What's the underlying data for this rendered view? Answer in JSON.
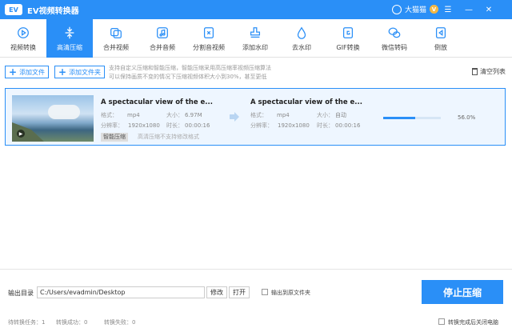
{
  "app": {
    "logo_text": "EV",
    "title": "EV视频转换器"
  },
  "user": {
    "name": "大猫猫",
    "badge": "V"
  },
  "toolbar": [
    {
      "name": "video-convert",
      "label": "视频转换",
      "icon": "play-circle-icon"
    },
    {
      "name": "compress",
      "label": "高清压缩",
      "icon": "compress-icon",
      "active": true
    },
    {
      "name": "merge-video",
      "label": "合并视频",
      "icon": "merge-video-icon"
    },
    {
      "name": "merge-audio",
      "label": "合并音频",
      "icon": "merge-audio-icon"
    },
    {
      "name": "split",
      "label": "分割音视频",
      "icon": "scissors-icon"
    },
    {
      "name": "add-watermark",
      "label": "添加水印",
      "icon": "stamp-icon"
    },
    {
      "name": "remove-watermark",
      "label": "去水印",
      "icon": "droplet-icon"
    },
    {
      "name": "gif",
      "label": "GIF转换",
      "icon": "gif-icon"
    },
    {
      "name": "wechat",
      "label": "微信转码",
      "icon": "wechat-icon"
    },
    {
      "name": "reverse",
      "label": "倒放",
      "icon": "reverse-icon"
    }
  ],
  "actions": {
    "add_file": "添加文件",
    "add_folder": "添加文件夹",
    "hint_line1": "支持自定义压缩和智能压缩，智能压缩采用高压缩率视频压缩算法",
    "hint_line2": "可以保持画质不变的情况下压缩视频体积大小到30%，甚至更低",
    "clear_list": "清空列表"
  },
  "file": {
    "source": {
      "name": "A spectacular view of the e...",
      "format_label": "格式：",
      "format": "mp4",
      "size_label": "大小：",
      "size": "6.97M",
      "res_label": "分辨率：",
      "resolution": "1920x1080",
      "dur_label": "时长：",
      "duration": "00:00:16"
    },
    "target": {
      "name": "A spectacular view of the e...",
      "format_label": "格式：",
      "format": "mp4",
      "size_label": "大小：",
      "size": "自动",
      "res_label": "分辨率：",
      "resolution": "1920x1080",
      "dur_label": "时长：",
      "duration": "00:00:16"
    },
    "tag": "智能压缩",
    "tag_note": "高清压缩不支持修改格式",
    "progress": 0.56,
    "progress_text": "56.0%"
  },
  "output": {
    "label": "输出目录",
    "path": "C:/Users/evadmin/Desktop",
    "modify": "修改",
    "open": "打开",
    "same_folder": "输出到原文件夹"
  },
  "stop_button": "停止压缩",
  "shutdown_label": "转换完成后关闭电脑",
  "status": {
    "pending": "待转换任务：1",
    "success": "转换成功：0",
    "fail": "转换失败：0"
  },
  "colors": {
    "accent": "#2a8ff7"
  }
}
